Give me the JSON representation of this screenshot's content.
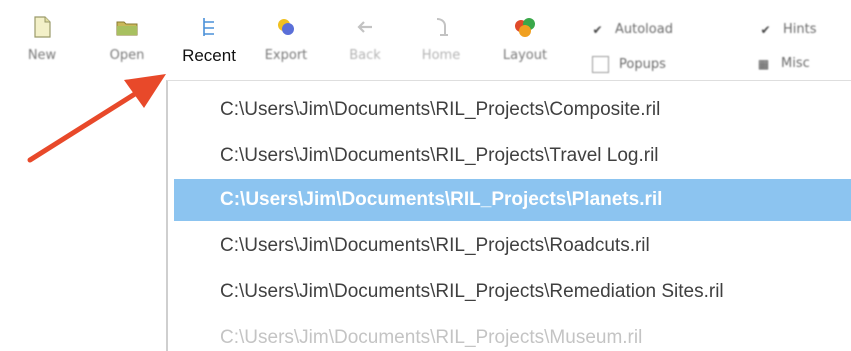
{
  "toolbar": {
    "buttons": [
      {
        "label": "New",
        "icon": "new-file-icon"
      },
      {
        "label": "Open",
        "icon": "folder-icon"
      },
      {
        "label": "Recent",
        "icon": "recent-list-icon"
      },
      {
        "label": "Export",
        "icon": "export-icon"
      },
      {
        "label": "Back",
        "icon": "back-arrow-icon"
      },
      {
        "label": "Home",
        "icon": "home-icon"
      },
      {
        "label": "Layout",
        "icon": "layout-icon"
      }
    ],
    "checks": [
      {
        "label": "Autoload",
        "checked": true
      },
      {
        "label": "Popups",
        "checked": false
      },
      {
        "label": "Hints",
        "checked": true
      },
      {
        "label": "Misc",
        "checked": false
      }
    ]
  },
  "recent_menu": {
    "items": [
      "C:\\Users\\Jim\\Documents\\RIL_Projects\\Composite.ril",
      "C:\\Users\\Jim\\Documents\\RIL_Projects\\Travel Log.ril",
      "C:\\Users\\Jim\\Documents\\RIL_Projects\\Planets.ril",
      "C:\\Users\\Jim\\Documents\\RIL_Projects\\Roadcuts.ril",
      "C:\\Users\\Jim\\Documents\\RIL_Projects\\Remediation Sites.ril",
      "C:\\Users\\Jim\\Documents\\RIL_Projects\\Museum.ril"
    ],
    "selected_index": 2
  },
  "colors": {
    "selection": "#8cc4f0",
    "arrow": "#e8492a"
  }
}
